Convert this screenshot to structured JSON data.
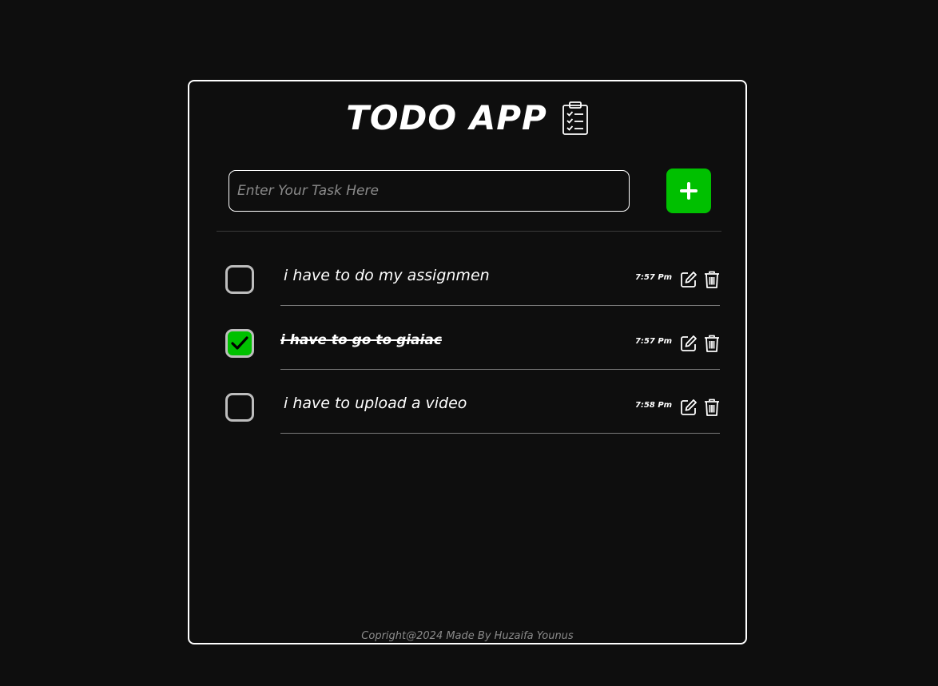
{
  "header": {
    "title": "TODO APP",
    "icon": "clipboard-list-icon"
  },
  "input": {
    "placeholder": "Enter Your Task Here",
    "value": ""
  },
  "add_button": {
    "icon": "plus-icon",
    "color": "#00c000"
  },
  "tasks": [
    {
      "text": "i have to do my assignmen",
      "time": "7:57 Pm",
      "completed": false
    },
    {
      "text": "i have to go to giaiac",
      "time": "7:57 Pm",
      "completed": true
    },
    {
      "text": "i have to upload a video",
      "time": "7:58 Pm",
      "completed": false
    }
  ],
  "footer": {
    "text": "Copright@2024 Made By Huzaifa Younus"
  },
  "colors": {
    "background": "#0e0e0e",
    "accent": "#00c000",
    "border": "#ffffff"
  }
}
